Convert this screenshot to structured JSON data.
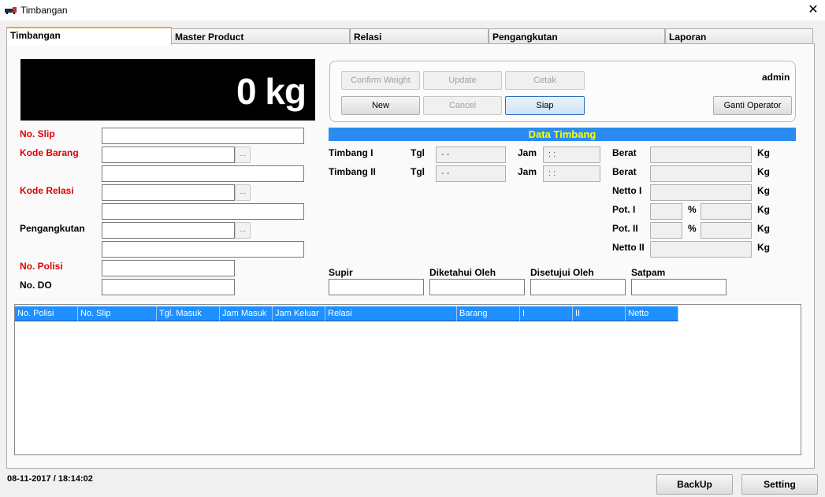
{
  "window": {
    "title": "Timbangan",
    "close_label": "✕"
  },
  "tabs": [
    "Timbangan",
    "Master Product",
    "Relasi",
    "Pengangkutan",
    "Laporan"
  ],
  "display": {
    "weight": "0 kg"
  },
  "left_form": {
    "no_slip_label": "No. Slip",
    "kode_barang_label": "Kode Barang",
    "kode_relasi_label": "Kode Relasi",
    "pengangkutan_label": "Pengangkutan",
    "no_polisi_label": "No. Polisi",
    "no_do_label": "No. DO",
    "browse_label": "..."
  },
  "buttons": {
    "confirm_weight": "Confirm Weight",
    "update": "Update",
    "cetak": "Cetak",
    "new": "New",
    "cancel": "Cancel",
    "siap": "Siap",
    "ganti_operator": "Ganti Operator",
    "user": "admin"
  },
  "data_timbang": {
    "title": "Data Timbang",
    "timbang1": "Timbang I",
    "timbang2": "Timbang II",
    "tgl": "Tgl",
    "jam": "Jam",
    "tgl_value": "- -",
    "jam_value": ": :",
    "berat": "Berat",
    "netto1": "Netto I",
    "pot1": "Pot. I",
    "pot2": "Pot. II",
    "netto2": "Netto II",
    "percent": "%",
    "kg": "Kg"
  },
  "signers": {
    "supir": "Supir",
    "diketahui": "Diketahui Oleh",
    "disetujui": "Disetujui Oleh",
    "satpam": "Satpam"
  },
  "grid": {
    "columns": [
      "No. Polisi",
      "No. Slip",
      "Tgl. Masuk",
      "Jam Masuk",
      "Jam Keluar",
      "Relasi",
      "Barang",
      "I",
      "II",
      "Netto"
    ]
  },
  "status": {
    "datetime": "08-11-2017 / 18:14:02"
  },
  "footer": {
    "backup": "BackUp",
    "setting": "Setting"
  },
  "colors": {
    "header_blue": "#1e90ff",
    "section_bar": "#2a8cf0",
    "section_text": "#ffff00",
    "label_red": "#e00000",
    "tab_accent": "#f4a23a"
  }
}
